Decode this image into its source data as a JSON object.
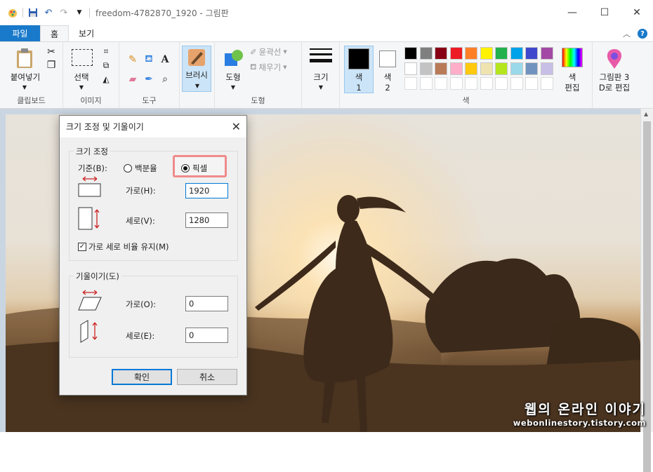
{
  "window": {
    "title": "freedom-4782870_1920 - 그림판"
  },
  "tabs": [
    {
      "label": "파일"
    },
    {
      "label": "홈"
    },
    {
      "label": "보기"
    }
  ],
  "ribbon": {
    "clipboard": {
      "paste_label": "붙여넣기",
      "group_label": "클립보드"
    },
    "image": {
      "select_label": "선택",
      "group_label": "이미지"
    },
    "tools": {
      "group_label": "도구"
    },
    "brush": {
      "label": "브러시"
    },
    "shapes": {
      "shapes_label": "도형",
      "outline_label": "윤곽선",
      "fill_label": "채우기",
      "group_label": "도형"
    },
    "size": {
      "label": "크기"
    },
    "color1": {
      "line1": "색",
      "line2": "1"
    },
    "color2": {
      "line1": "색",
      "line2": "2"
    },
    "edit_colors": {
      "line1": "색",
      "line2": "편집"
    },
    "paint3d": {
      "line1": "그림판 3",
      "line2": "D로 편집"
    },
    "colors_group_label": "색",
    "palette_row1": [
      "#000000",
      "#7f7f7f",
      "#880015",
      "#ed1c24",
      "#ff7f27",
      "#fff200",
      "#22b14c",
      "#00a2e8",
      "#3f48cc",
      "#a349a4"
    ],
    "palette_row2": [
      "#ffffff",
      "#c3c3c3",
      "#b97a57",
      "#ffaec9",
      "#ffc90e",
      "#efe4b0",
      "#b5e61d",
      "#99d9ea",
      "#7092be",
      "#c8bfe7"
    ]
  },
  "dialog": {
    "title": "크기 조정 및 기울이기",
    "resize_legend": "크기 조정",
    "basis_label": "기준(B):",
    "percent_label": "백분율",
    "pixel_label": "픽셀",
    "horizontal_label": "가로(H):",
    "horizontal_value": "1920",
    "vertical_label": "세로(V):",
    "vertical_value": "1280",
    "keep_ratio_label": "가로 세로 비율 유지(M)",
    "skew_legend": "기울이기(도)",
    "skew_h_label": "가로(O):",
    "skew_h_value": "0",
    "skew_v_label": "세로(E):",
    "skew_v_value": "0",
    "ok_label": "확인",
    "cancel_label": "취소"
  },
  "watermark": {
    "line1": "웹의 온라인 이야기",
    "line2": "webonlinestory.tistory.com"
  }
}
